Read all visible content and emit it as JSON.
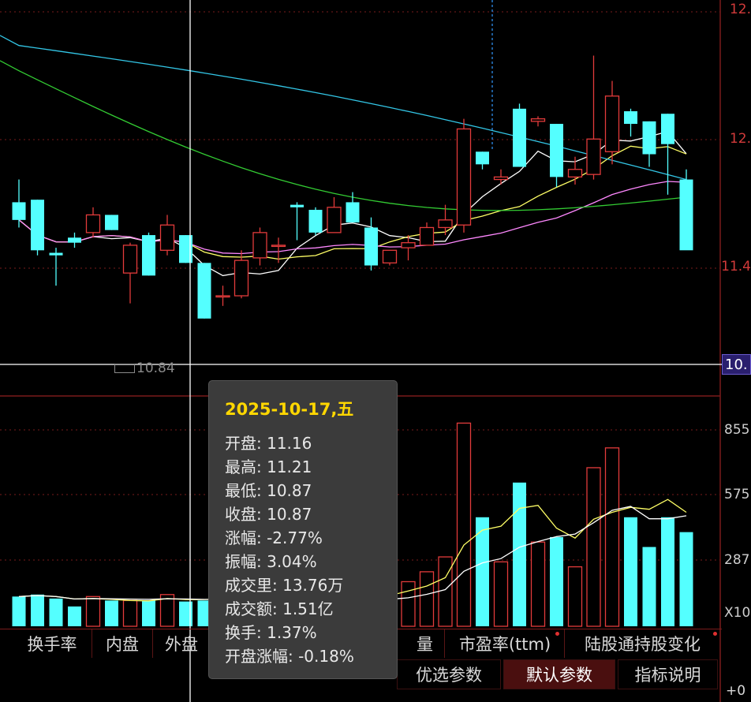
{
  "price_axis": {
    "labels": [
      "12.",
      "12.",
      "11.4",
      "10."
    ],
    "crosshair_value": "10."
  },
  "low_marker": {
    "text": "10.84"
  },
  "volume_axis": {
    "labels": [
      "855",
      "575",
      "287",
      "X10"
    ]
  },
  "indicator_tabs": [
    {
      "label": "换手率",
      "dot": false
    },
    {
      "label": "内盘",
      "dot": false
    },
    {
      "label": "外盘",
      "dot": false
    },
    {
      "label": "量",
      "dot": false
    },
    {
      "label": "市盈率(ttm)",
      "dot": true
    },
    {
      "label": "陆股通持股变化",
      "dot": true
    }
  ],
  "param_buttons": [
    {
      "label": "优选参数",
      "active": false
    },
    {
      "label": "默认参数",
      "active": true
    },
    {
      "label": "指标说明",
      "active": false
    }
  ],
  "bottom_right_label": "+0",
  "tooltip": {
    "date": "2025-10-17,五",
    "rows": [
      "开盘: 11.16",
      "最高: 11.21",
      "最低: 10.87",
      "收盘: 10.87",
      "涨幅: -2.77%",
      "振幅: 3.04%",
      "成交里: 13.76万",
      "成交额: 1.51亿",
      "换手: 1.37%",
      "开盘涨幅: -0.18%"
    ]
  },
  "colors": {
    "up": "#e23b3b",
    "down": "#54ffff",
    "ma5": "#ffffff",
    "ma10": "#ffff66",
    "ma20": "#ff88ff",
    "ma60": "#33cc33",
    "ma120": "#33c6e6",
    "grid": "#7a1b1b"
  },
  "chart_data": {
    "type": "candlestick",
    "candles": [
      {
        "o": 11.43,
        "h": 11.52,
        "l": 11.33,
        "c": 11.36,
        "v": 30
      },
      {
        "o": 11.44,
        "h": 11.44,
        "l": 11.22,
        "c": 11.24,
        "v": 32
      },
      {
        "o": 11.23,
        "h": 11.25,
        "l": 11.1,
        "c": 11.22,
        "v": 28
      },
      {
        "o": 11.29,
        "h": 11.31,
        "l": 11.25,
        "c": 11.27,
        "v": 20
      },
      {
        "o": 11.31,
        "h": 11.41,
        "l": 11.29,
        "c": 11.38,
        "v": 30
      },
      {
        "o": 11.38,
        "h": 11.38,
        "l": 11.32,
        "c": 11.32,
        "v": 26
      },
      {
        "o": 11.15,
        "h": 11.27,
        "l": 11.03,
        "c": 11.26,
        "v": 26
      },
      {
        "o": 11.3,
        "h": 11.31,
        "l": 11.14,
        "c": 11.14,
        "v": 26
      },
      {
        "o": 11.24,
        "h": 11.38,
        "l": 11.22,
        "c": 11.34,
        "v": 32
      },
      {
        "o": 11.3,
        "h": 11.3,
        "l": 11.19,
        "c": 11.19,
        "v": 25
      },
      {
        "o": 11.19,
        "h": 11.19,
        "l": 10.97,
        "c": 10.97,
        "v": 26
      },
      {
        "o": 11.06,
        "h": 11.1,
        "l": 11.02,
        "c": 11.06,
        "v": 30
      },
      {
        "o": 11.06,
        "h": 11.24,
        "l": 11.05,
        "c": 11.2,
        "v": 20
      },
      {
        "o": 11.21,
        "h": 11.33,
        "l": 11.18,
        "c": 11.31,
        "v": 22
      },
      {
        "o": 11.26,
        "h": 11.29,
        "l": 11.19,
        "c": 11.26,
        "v": 20
      },
      {
        "o": 11.42,
        "h": 11.43,
        "l": 11.28,
        "c": 11.41,
        "v": 25
      },
      {
        "o": 11.4,
        "h": 11.41,
        "l": 11.3,
        "c": 11.31,
        "v": 22
      },
      {
        "o": 11.31,
        "h": 11.45,
        "l": 11.31,
        "c": 11.41,
        "v": 30
      },
      {
        "o": 11.43,
        "h": 11.47,
        "l": 11.35,
        "c": 11.35,
        "v": 28
      },
      {
        "o": 11.33,
        "h": 11.37,
        "l": 11.16,
        "c": 11.18,
        "v": 40
      },
      {
        "o": 11.19,
        "h": 11.24,
        "l": 11.18,
        "c": 11.24,
        "v": 35
      },
      {
        "o": 11.25,
        "h": 11.3,
        "l": 11.2,
        "c": 11.27,
        "v": 45
      },
      {
        "o": 11.26,
        "h": 11.35,
        "l": 11.26,
        "c": 11.33,
        "v": 55
      },
      {
        "o": 11.33,
        "h": 11.42,
        "l": 11.3,
        "c": 11.36,
        "v": 70
      },
      {
        "o": 11.34,
        "h": 11.76,
        "l": 11.31,
        "c": 11.72,
        "v": 205
      },
      {
        "o": 11.63,
        "h": 11.63,
        "l": 11.56,
        "c": 11.58,
        "v": 110
      },
      {
        "o": 11.52,
        "h": 11.56,
        "l": 11.5,
        "c": 11.53,
        "v": 65
      },
      {
        "o": 11.8,
        "h": 11.82,
        "l": 11.57,
        "c": 11.57,
        "v": 145
      },
      {
        "o": 11.75,
        "h": 11.77,
        "l": 11.73,
        "c": 11.76,
        "v": 85
      },
      {
        "o": 11.74,
        "h": 11.74,
        "l": 11.49,
        "c": 11.53,
        "v": 90
      },
      {
        "o": 11.53,
        "h": 11.61,
        "l": 11.5,
        "c": 11.56,
        "v": 60
      },
      {
        "o": 11.54,
        "h": 12.01,
        "l": 11.52,
        "c": 11.68,
        "v": 160
      },
      {
        "o": 11.63,
        "h": 11.91,
        "l": 11.58,
        "c": 11.85,
        "v": 180
      },
      {
        "o": 11.79,
        "h": 11.8,
        "l": 11.69,
        "c": 11.74,
        "v": 110
      },
      {
        "o": 11.75,
        "h": 11.75,
        "l": 11.57,
        "c": 11.62,
        "v": 80
      },
      {
        "o": 11.78,
        "h": 11.78,
        "l": 11.46,
        "c": 11.66,
        "v": 110
      },
      {
        "o": 11.52,
        "h": 11.56,
        "l": 11.26,
        "c": 11.24,
        "v": 95
      }
    ],
    "ylim": [
      10.67,
      12.23
    ],
    "moving_averages": [
      "MA5",
      "MA10",
      "MA20",
      "MA60",
      "MA120"
    ],
    "volume_ylim": [
      0,
      230
    ]
  }
}
